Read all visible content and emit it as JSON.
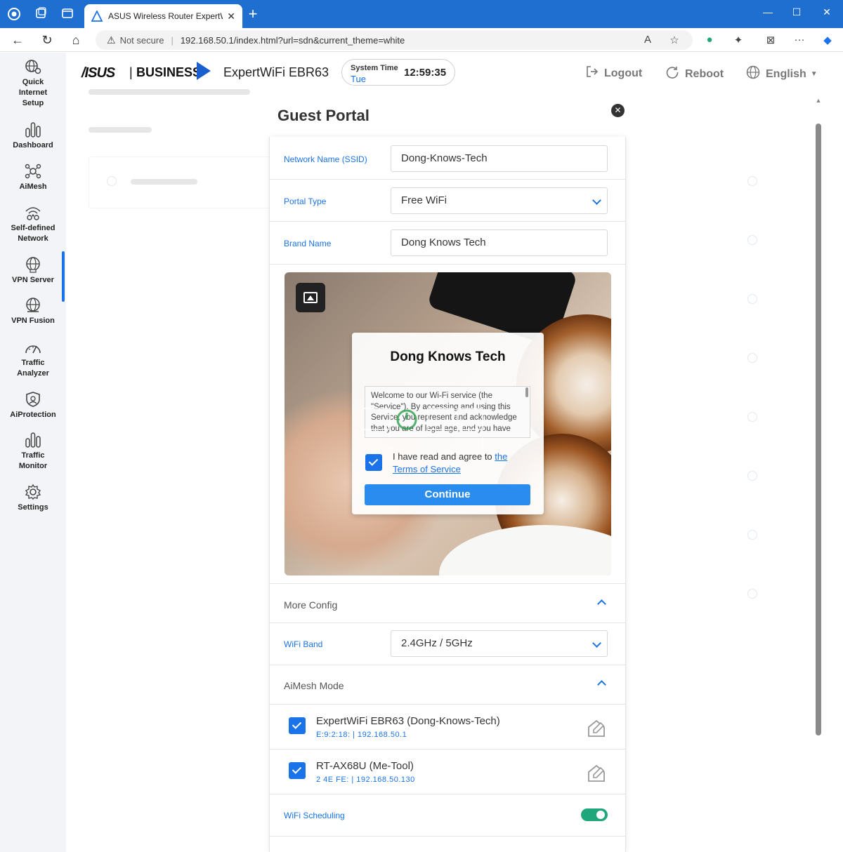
{
  "browser": {
    "tab_title": "ASUS Wireless Router ExpertWiFi",
    "not_secure": "Not secure",
    "url": "192.168.50.1/index.html?url=sdn&current_theme=white"
  },
  "sidebar": {
    "items": [
      {
        "label": "Quick Internet Setup",
        "icon": "globe-settings-icon"
      },
      {
        "label": "Dashboard",
        "icon": "bar-chart-icon"
      },
      {
        "label": "AiMesh",
        "icon": "mesh-icon"
      },
      {
        "label": "Self-defined Network",
        "icon": "network-icon"
      },
      {
        "label": "VPN Server",
        "icon": "vpn-server-icon"
      },
      {
        "label": "VPN Fusion",
        "icon": "vpn-fusion-icon"
      },
      {
        "label": "Traffic Analyzer",
        "icon": "traffic-analyzer-icon"
      },
      {
        "label": "AiProtection",
        "icon": "shield-icon"
      },
      {
        "label": "Traffic Monitor",
        "icon": "traffic-monitor-icon"
      },
      {
        "label": "Settings",
        "icon": "gear-icon"
      }
    ]
  },
  "header": {
    "logo": "/ISUS",
    "logo_sep": "|",
    "logo_business": "BUSINESS",
    "model": "ExpertWiFi EBR63",
    "system_time_label": "System Time",
    "system_time_day": "Tue",
    "system_time": "12:59:35",
    "logout": "Logout",
    "reboot": "Reboot",
    "language": "English"
  },
  "modal": {
    "title": "Guest Portal",
    "ssid_label": "Network Name (SSID)",
    "ssid_value": "Dong-Knows-Tech",
    "portal_type_label": "Portal Type",
    "portal_type_value": "Free WiFi",
    "brand_label": "Brand Name",
    "brand_value": "Dong Knows Tech",
    "preview": {
      "title": "Dong Knows Tech",
      "terms": "Welcome to our Wi-Fi service (the \"Service\"). By accessing and using this Service, you represent and acknowledge that you are of legal age, and you have",
      "agree_text": "I have read and agree to",
      "agree_link": "the Terms of Service",
      "continue": "Continue"
    },
    "more_config": "More Config",
    "wifi_band_label": "WiFi Band",
    "wifi_band_value": "2.4GHz / 5GHz",
    "aimesh_mode": "AiMesh Mode",
    "devices": [
      {
        "name": "ExpertWiFi EBR63 (Dong-Knows-Tech)",
        "sub": "E:9:2:18:  | 192.168.50.1"
      },
      {
        "name": "RT-AX68U (Me-Tool)",
        "sub": "2  4E FE:  | 192.168.50.130"
      }
    ],
    "wifi_scheduling_label": "WiFi Scheduling",
    "wifi_scheduling_on": true
  },
  "colors": {
    "accent": "#1a73e8",
    "toggle_on": "#1fa67a",
    "titlebar": "#1f6fd0"
  }
}
